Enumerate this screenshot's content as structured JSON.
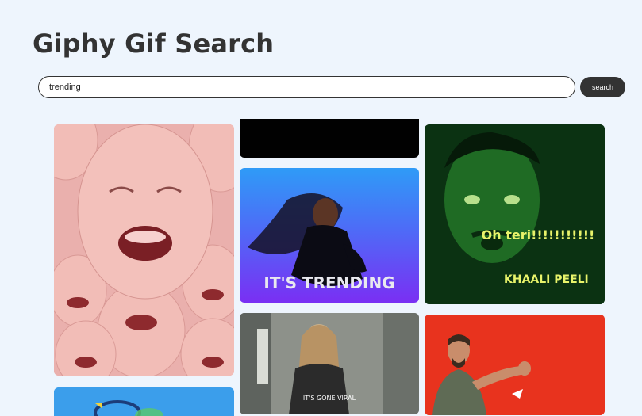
{
  "header": {
    "title": "Giphy Gif Search"
  },
  "search": {
    "value": "trending",
    "button_label": "search"
  },
  "gifs": [
    {
      "name": "crying-baby-gif"
    },
    {
      "name": "partial-blue-gif"
    },
    {
      "name": "black-gif"
    },
    {
      "name": "its-trending-gif",
      "caption": "IT'S TRENDING"
    },
    {
      "name": "its-gone-viral-gif",
      "caption": "IT'S GONE VIRAL"
    },
    {
      "name": "oh-teri-gif",
      "caption": "Oh teri!!!!!!!!!!!",
      "logo": "KHAALI PEELI"
    },
    {
      "name": "dancing-man-gif"
    }
  ],
  "colors": {
    "background": "#eef5fd",
    "button": "#333333",
    "text": "#333333"
  }
}
